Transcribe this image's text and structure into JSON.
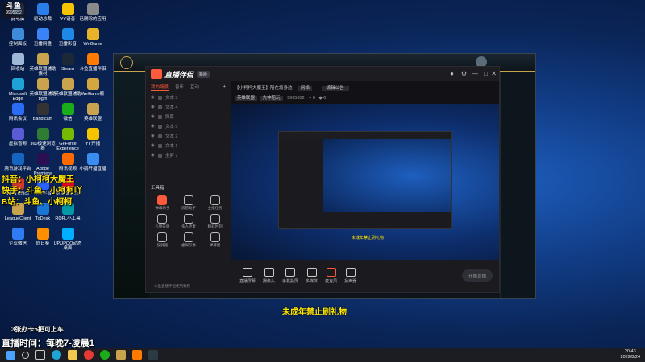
{
  "overlay": {
    "logo_text": "斗鱼",
    "room_number": "9995652",
    "line1": "抖音：小柯柯大魔王",
    "line2": "快手：斗鱼、小柯柯吖",
    "line3": "B站：斗鱼、小柯柯",
    "promo": "3张办卡5把可上车",
    "schedule": "直播时间：每晚7-凌晨1",
    "notice": "未成年禁止刷礼物"
  },
  "desktop_icons": [
    {
      "label": "此电脑",
      "color": "#4aa3ff"
    },
    {
      "label": "驱动总裁",
      "color": "#2b7de9"
    },
    {
      "label": "YY语音",
      "color": "#f5c400"
    },
    {
      "label": "已删除的应用",
      "color": "#8a8a8a"
    },
    {
      "label": "控制面板",
      "color": "#3d8bd9"
    },
    {
      "label": "迅雷网盘",
      "color": "#3b82f6"
    },
    {
      "label": "迅雷影音",
      "color": "#1e88e5"
    },
    {
      "label": "WeGame",
      "color": "#e8b22a"
    },
    {
      "label": "回收站",
      "color": "#9fb8d6"
    },
    {
      "label": "英雄联盟辅助素材",
      "color": "#c9a34e"
    },
    {
      "label": "Steam",
      "color": "#1b2838"
    },
    {
      "label": "斗鱼直播伴侣",
      "color": "#ff7a00"
    },
    {
      "label": "Microsoft Edge",
      "color": "#1fa3d6"
    },
    {
      "label": "英雄联盟辅助bgm",
      "color": "#c9a34e"
    },
    {
      "label": "英雄联盟辅助",
      "color": "#c9a34e"
    },
    {
      "label": "WeGame版",
      "color": "#d4a640"
    },
    {
      "label": "腾讯会议",
      "color": "#2a6df4"
    },
    {
      "label": "Bandicam",
      "color": "#333333"
    },
    {
      "label": "微信",
      "color": "#1aad19"
    },
    {
      "label": "英雄联盟",
      "color": "#c9a34e"
    },
    {
      "label": "虚拟音频",
      "color": "#5b5bd6"
    },
    {
      "label": "360极速浏览器",
      "color": "#2e7d32"
    },
    {
      "label": "GeForce Experience",
      "color": "#76b900"
    },
    {
      "label": "YY开播",
      "color": "#f5c400"
    },
    {
      "label": "腾讯游戏平台",
      "color": "#1565c0"
    },
    {
      "label": "Adobe Premiere",
      "color": "#2a0f52"
    },
    {
      "label": "腾讯视频",
      "color": "#ff6a00"
    },
    {
      "label": "小鹅开播直播",
      "color": "#3a8df0"
    },
    {
      "label": "WPS Office",
      "color": "#d33a2c"
    },
    {
      "label": "完美平台",
      "color": "#2962ff"
    },
    {
      "label": "网易云音乐",
      "color": "#e60026"
    },
    {
      "label": "",
      "color": "#000000"
    },
    {
      "label": "LeagueClient",
      "color": "#c9a34e"
    },
    {
      "label": "ToDesk",
      "color": "#1976d2"
    },
    {
      "label": "ROFL小工具",
      "color": "#0097a7"
    },
    {
      "label": "",
      "color": "#000000"
    },
    {
      "label": "企业微信",
      "color": "#2f7bf2"
    },
    {
      "label": "向日葵",
      "color": "#ff8f00"
    },
    {
      "label": "UPUPOO动态桌面",
      "color": "#00b0ff"
    },
    {
      "label": "",
      "color": "#000000"
    }
  ],
  "app": {
    "name": "直播伴侣",
    "version_badge": "新版",
    "tabs": [
      "我的场景",
      "音乐",
      "互动"
    ],
    "scenes": [
      "文本 3",
      "文本 4",
      "屏幕",
      "文本 5",
      "文本 2",
      "文本 1",
      "全屏 1"
    ],
    "tools_title": "工具箱",
    "tools": [
      "弹幕助手",
      "房管助手",
      "主播任务",
      "礼物答谢",
      "多人连麦",
      "精彩时刻",
      "投屏器",
      "虚拟形象",
      "弹幕图"
    ],
    "footer_link": "斗鱼直播伴侣使用教程",
    "room_title": "【小柯柯大魔王】陪在您身边",
    "room_tag": "网络",
    "room_edit": "编辑公告",
    "category": "英雄联盟",
    "sub_category": "大神陪玩",
    "room_id": "9995652",
    "fans": "0",
    "likes": "0",
    "bottom_buttons": [
      "直播屏幕",
      "摄像头",
      "手机投屏",
      "多媒体",
      "麦克风",
      "扬声器"
    ],
    "start_label": "开始直播"
  },
  "taskbar": {
    "time": "20:43",
    "date": "2022/8/24"
  },
  "colors": {
    "accent": "#ff5a3c",
    "overlay_yellow": "#ffe600",
    "taskbar": "#1b1d22"
  }
}
